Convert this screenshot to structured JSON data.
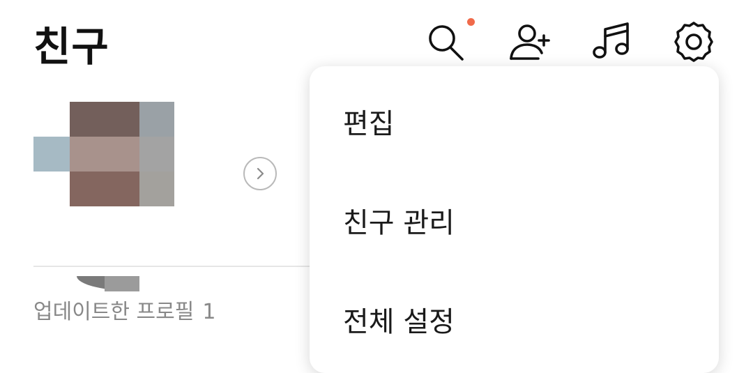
{
  "header": {
    "title": "친구",
    "icons": [
      "search-icon",
      "add-friend-icon",
      "music-icon",
      "settings-icon"
    ],
    "notification_dot_color": "#f06a4a"
  },
  "profile_section": {
    "updated_profiles_label": "업데이트한 프로필",
    "updated_profiles_count": "1"
  },
  "menu": {
    "items": [
      {
        "label": "편집"
      },
      {
        "label": "친구 관리"
      },
      {
        "label": "전체 설정"
      }
    ]
  }
}
